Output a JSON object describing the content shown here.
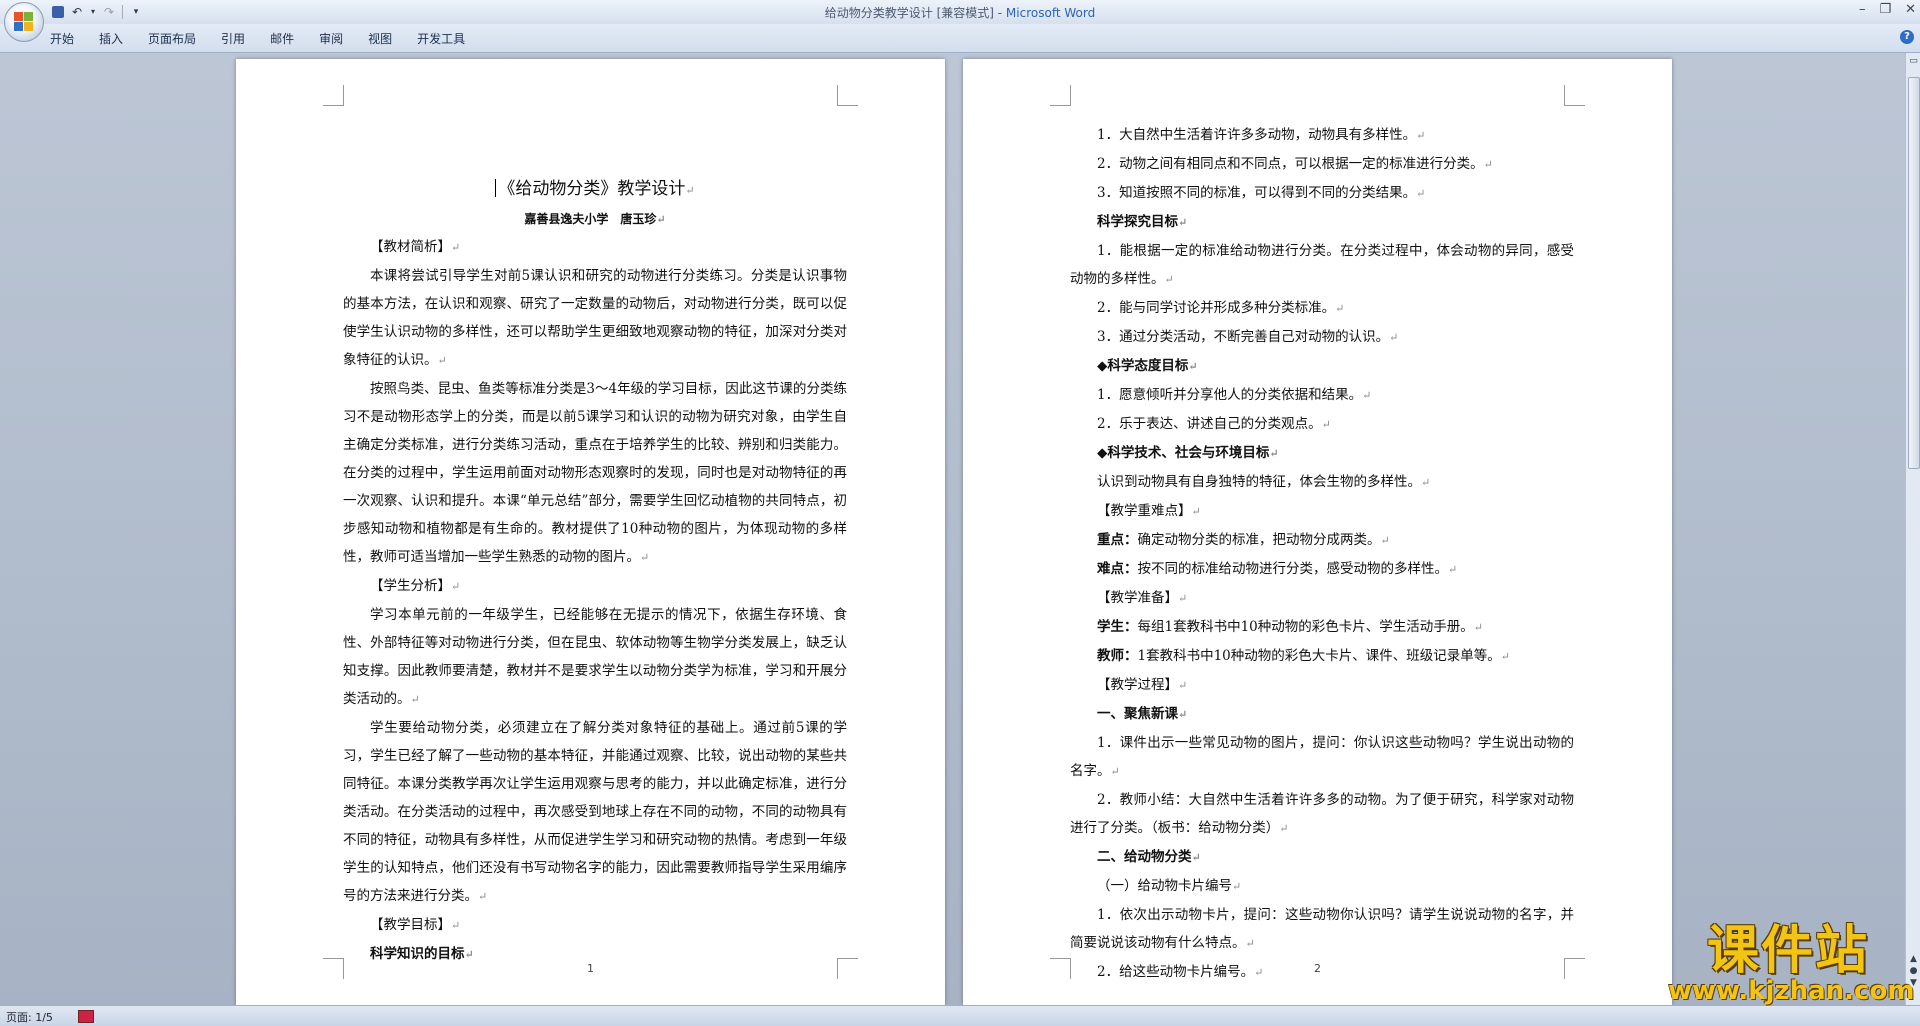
{
  "window": {
    "title_doc": "给动物分类教学设计 [兼容模式] - ",
    "title_app": "Microsoft Word"
  },
  "ribbon": {
    "tabs": [
      "开始",
      "插入",
      "页面布局",
      "引用",
      "邮件",
      "审阅",
      "视图",
      "开发工具"
    ]
  },
  "page1": {
    "title": "《给动物分类》教学设计",
    "author": "嘉善县逸夫小学　唐玉珍",
    "paragraphs": [
      {
        "type": "heading",
        "text": "【教材简析】"
      },
      {
        "type": "para",
        "text": "本课将尝试引导学生对前5课认识和研究的动物进行分类练习。分类是认识事物的基本方法，在认识和观察、研究了一定数量的动物后，对动物进行分类，既可以促使学生认识动物的多样性，还可以帮助学生更细致地观察动物的特征，加深对分类对象特征的认识。"
      },
      {
        "type": "para",
        "text": "按照鸟类、昆虫、鱼类等标准分类是3～4年级的学习目标，因此这节课的分类练习不是动物形态学上的分类，而是以前5课学习和认识的动物为研究对象，由学生自主确定分类标准，进行分类练习活动，重点在于培养学生的比较、辨别和归类能力。在分类的过程中，学生运用前面对动物形态观察时的发现，同时也是对动物特征的再一次观察、认识和提升。本课“单元总结”部分，需要学生回忆动植物的共同特点，初步感知动物和植物都是有生命的。教材提供了10种动物的图片，为体现动物的多样性，教师可适当增加一些学生熟悉的动物的图片。"
      },
      {
        "type": "heading",
        "text": "【学生分析】"
      },
      {
        "type": "para",
        "text": "学习本单元前的一年级学生，已经能够在无提示的情况下，依据生存环境、食性、外部特征等对动物进行分类，但在昆虫、软体动物等生物学分类发展上，缺乏认知支撑。因此教师要清楚，教材并不是要求学生以动物分类学为标准，学习和开展分类活动的。"
      },
      {
        "type": "para",
        "text": "学生要给动物分类，必须建立在了解分类对象特征的基础上。通过前5课的学习，学生已经了解了一些动物的基本特征，并能通过观察、比较，说出动物的某些共同特征。本课分类教学再次让学生运用观察与思考的能力，并以此确定标准，进行分类活动。在分类活动的过程中，再次感受到地球上存在不同的动物，不同的动物具有不同的特征，动物具有多样性，从而促进学生学习和研究动物的热情。考虑到一年级学生的认知特点，他们还没有书写动物名字的能力，因此需要教师指导学生采用编序号的方法来进行分类。"
      },
      {
        "type": "heading",
        "text": "【教学目标】"
      },
      {
        "type": "bold",
        "text": "科学知识的目标"
      }
    ],
    "page_number": "1"
  },
  "page2": {
    "paragraphs": [
      {
        "type": "item",
        "text": "1．大自然中生活着许许多多动物，动物具有多样性。"
      },
      {
        "type": "item",
        "text": "2．动物之间有相同点和不同点，可以根据一定的标准进行分类。"
      },
      {
        "type": "item",
        "text": "3．知道按照不同的标准，可以得到不同的分类结果。"
      },
      {
        "type": "bold",
        "text": "科学探究目标"
      },
      {
        "type": "wrap",
        "text": "1．能根据一定的标准给动物进行分类。在分类过程中，体会动物的异同，感受动物的多样性。"
      },
      {
        "type": "item",
        "text": "2．能与同学讨论并形成多种分类标准。"
      },
      {
        "type": "item",
        "text": "3．通过分类活动，不断完善自己对动物的认识。"
      },
      {
        "type": "bold",
        "text": "◆科学态度目标"
      },
      {
        "type": "item",
        "text": "1．愿意倾听并分享他人的分类依据和结果。"
      },
      {
        "type": "item",
        "text": "2．乐于表达、讲述自己的分类观点。"
      },
      {
        "type": "bold",
        "text": "◆科学技术、社会与环境目标"
      },
      {
        "type": "item",
        "text": "认识到动物具有自身独特的特征，体会生物的多样性。"
      },
      {
        "type": "item",
        "text": "【教学重难点】"
      },
      {
        "type": "label",
        "label": "重点：",
        "text": "确定动物分类的标准，把动物分成两类。"
      },
      {
        "type": "label",
        "label": "难点：",
        "text": "按不同的标准给动物进行分类，感受动物的多样性。"
      },
      {
        "type": "item",
        "text": "【教学准备】"
      },
      {
        "type": "label",
        "label": "学生：",
        "text": "每组1套教科书中10种动物的彩色卡片、学生活动手册。"
      },
      {
        "type": "label",
        "label": "教师：",
        "text": "1套教科书中10种动物的彩色大卡片、课件、班级记录单等。"
      },
      {
        "type": "item",
        "text": "【教学过程】"
      },
      {
        "type": "bold",
        "text": "一、聚焦新课"
      },
      {
        "type": "wrap",
        "text": "1．课件出示一些常见动物的图片，提问：你认识这些动物吗？学生说出动物的名字。"
      },
      {
        "type": "wrap",
        "text": "2．教师小结：大自然中生活着许许多多的动物。为了便于研究，科学家对动物进行了分类。（板书：给动物分类）"
      },
      {
        "type": "bold",
        "text": "二、给动物分类"
      },
      {
        "type": "item",
        "text": "（一）给动物卡片编号"
      },
      {
        "type": "wrap",
        "text": "1．依次出示动物卡片，提问：这些动物你认识吗？请学生说说动物的名字，并简要说说该动物有什么特点。"
      },
      {
        "type": "item",
        "text": "2．给这些动物卡片编号。"
      }
    ],
    "page_number": "2"
  },
  "statusbar": {
    "page_info": "页面: 1/5"
  },
  "watermark": {
    "cn": "课件站",
    "url": "www.kjzhan.com"
  }
}
